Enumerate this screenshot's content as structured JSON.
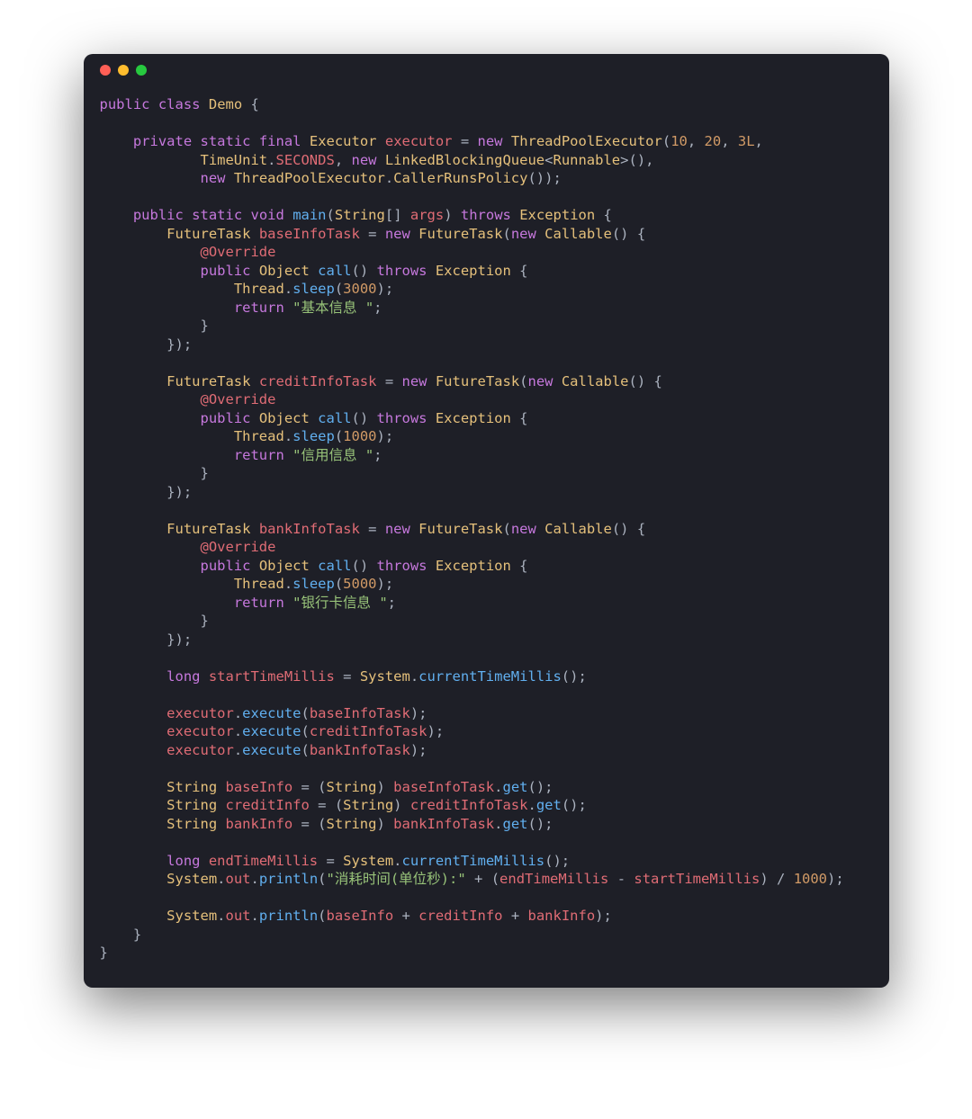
{
  "window": {
    "dot_red": "red",
    "dot_yellow": "yellow",
    "dot_green": "green"
  },
  "kw": {
    "public": "public",
    "class": "class",
    "private": "private",
    "static": "static",
    "final": "final",
    "new": "new",
    "void": "void",
    "throws": "throws",
    "return": "return",
    "long": "long"
  },
  "ty": {
    "Demo": "Demo",
    "Executor": "Executor",
    "ThreadPoolExecutor": "ThreadPoolExecutor",
    "TimeUnit": "TimeUnit",
    "LinkedBlockingQueue": "LinkedBlockingQueue",
    "Runnable": "Runnable",
    "CallerRunsPolicy": "CallerRunsPolicy",
    "String": "String",
    "FutureTask": "FutureTask",
    "Callable": "Callable",
    "Object": "Object",
    "Exception": "Exception",
    "Thread": "Thread",
    "System": "System"
  },
  "id": {
    "executor": "executor",
    "args": "args",
    "SECONDS": "SECONDS",
    "baseInfoTask": "baseInfoTask",
    "creditInfoTask": "creditInfoTask",
    "bankInfoTask": "bankInfoTask",
    "startTimeMillis": "startTimeMillis",
    "endTimeMillis": "endTimeMillis",
    "baseInfo": "baseInfo",
    "creditInfo": "creditInfo",
    "bankInfo": "bankInfo",
    "out": "out",
    "Override": "@Override"
  },
  "fn": {
    "main": "main",
    "call": "call",
    "sleep": "sleep",
    "currentTimeMillis": "currentTimeMillis",
    "execute": "execute",
    "get": "get",
    "println": "println"
  },
  "lit": {
    "n10": "10",
    "n20": "20",
    "n3L": "3L",
    "n3000": "3000",
    "n1000": "1000",
    "n5000": "5000",
    "d1000": "1000"
  },
  "str": {
    "base": "\"基本信息 \"",
    "credit": "\"信用信息 \"",
    "bank": "\"银行卡信息 \"",
    "elapsed": "\"消耗时间(单位秒):\""
  },
  "p": {
    "ob": " {",
    "sp": " ",
    "eq": " = ",
    "c": ", ",
    "lp": "(",
    "rp": ")",
    "scl": ";",
    "rpcl": ");",
    "arr": "[] ",
    "lt": "<",
    "gt": ">",
    "emptyNew": "(),",
    "emptyEnd": "());",
    "unitNew": "() {",
    "closeInner": "            }",
    "closeAnon": "        });",
    "closeMain": "    }",
    "closeClass": "}",
    "dot": ".",
    "plus": " + ",
    "minus": " - ",
    "div": " / ",
    "closeBrace": "}",
    "callEnd": "();",
    "castOpen": " = (",
    "castClose": ") ",
    "parenOnly": "("
  }
}
